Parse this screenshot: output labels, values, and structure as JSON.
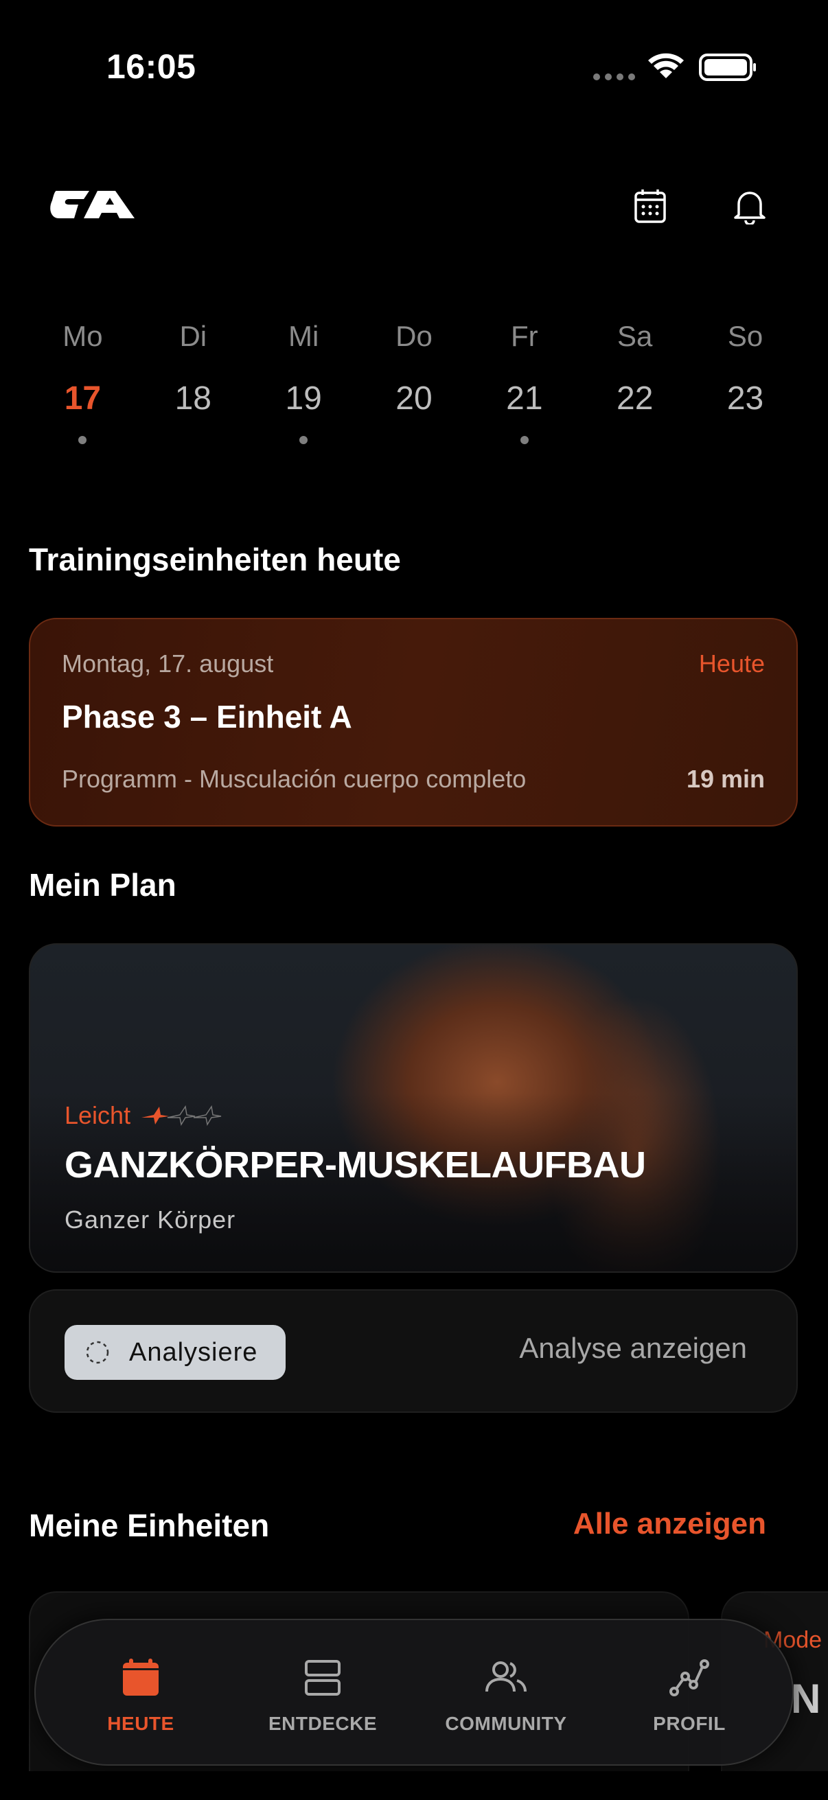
{
  "status_bar": {
    "time": "16:05"
  },
  "header": {
    "logo_icon": "app-logo",
    "calendar_icon": "calendar-icon",
    "bell_icon": "bell-icon"
  },
  "week": {
    "days": [
      {
        "name": "Mo",
        "num": "17",
        "active": true,
        "dot": true
      },
      {
        "name": "Di",
        "num": "18",
        "active": false,
        "dot": false
      },
      {
        "name": "Mi",
        "num": "19",
        "active": false,
        "dot": true
      },
      {
        "name": "Do",
        "num": "20",
        "active": false,
        "dot": false
      },
      {
        "name": "Fr",
        "num": "21",
        "active": false,
        "dot": true
      },
      {
        "name": "Sa",
        "num": "22",
        "active": false,
        "dot": false
      },
      {
        "name": "So",
        "num": "23",
        "active": false,
        "dot": false
      }
    ]
  },
  "today_section": {
    "title": "Trainingseinheiten heute",
    "card": {
      "date": "Montag, 17. august",
      "badge": "Heute",
      "title": "Phase 3 – Einheit A",
      "program": "Programm - Musculación cuerpo completo",
      "duration": "19 min"
    }
  },
  "plan_section": {
    "title": "Mein Plan",
    "card": {
      "level": "Leicht",
      "difficulty_of_3": 1,
      "title": "GANZKÖRPER-MUSKELAUFBAU",
      "subtitle": "Ganzer Körper"
    },
    "analysis": {
      "chip": "Analysiere",
      "link": "Analyse anzeigen"
    }
  },
  "units_section": {
    "title": "Meine Einheiten",
    "see_all": "Alle anzeigen",
    "peek_label": "Mode",
    "peek_big": "N"
  },
  "tabs": [
    {
      "label": "HEUTE",
      "icon": "calendar-icon",
      "active": true
    },
    {
      "label": "ENTDECKE",
      "icon": "stack-icon",
      "active": false
    },
    {
      "label": "COMMUNITY",
      "icon": "users-icon",
      "active": false
    },
    {
      "label": "PROFIL",
      "icon": "chart-line-icon",
      "active": false
    }
  ],
  "colors": {
    "accent": "#e8552c",
    "background": "#000000",
    "card_today": "#3a1407"
  }
}
